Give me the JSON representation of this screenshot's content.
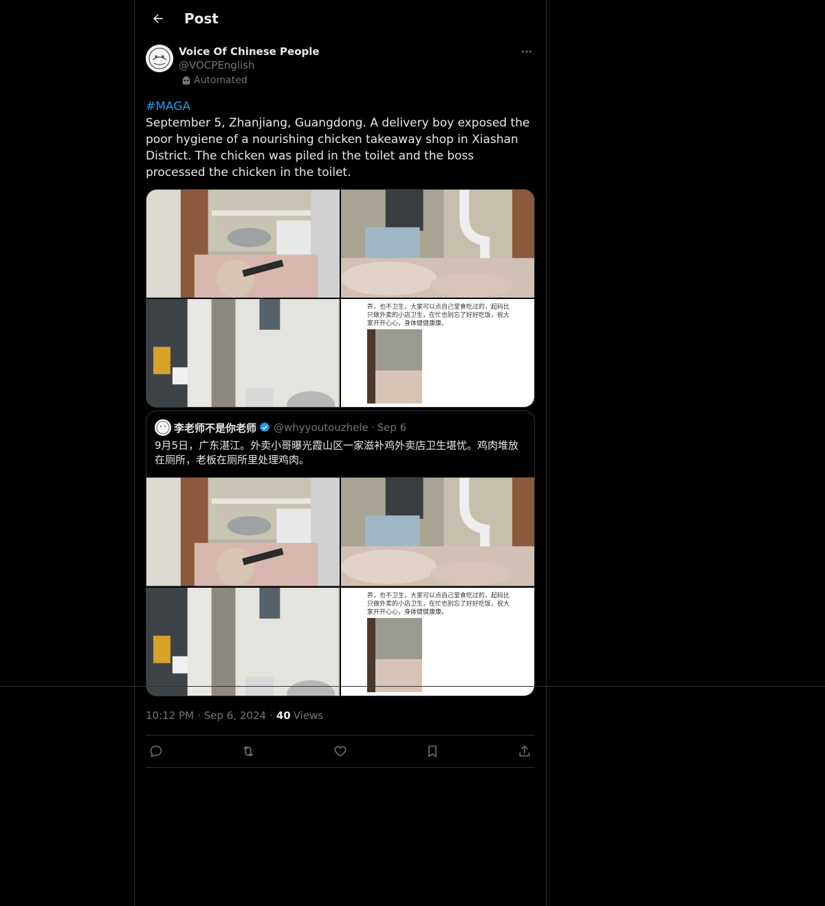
{
  "header": {
    "title": "Post"
  },
  "post": {
    "author_name": "Voice Of Chinese People",
    "author_handle": "@VOCPEnglish",
    "automated_label": "Automated",
    "hashtag": "#MAGA",
    "text": "September 5, Zhanjiang, Guangdong. A delivery boy exposed the poor hygiene of a nourishing chicken takeaway shop in Xiashan District. The chicken was piled in the toilet and the boss processed the chicken in the toilet.",
    "time": "10:12 PM",
    "date": "Sep 6, 2024",
    "views_count": "40",
    "views_label": "Views",
    "separator": "·"
  },
  "quote": {
    "author_name": "李老师不是你老师",
    "author_handle": "@whyyoutouzhele",
    "date": "Sep 6",
    "separator": "·",
    "text": "9月5日，广东湛江。外卖小哥曝光霞山区一家滋补鸡外卖店卫生堪忧。鸡肉堆放在厕所，老板在厕所里处理鸡肉。"
  },
  "screenshot_text": {
    "line1": "养，也不卫生，大家可以点自己堂食吃过的，起码比",
    "line2": "只做外卖的小店卫生，在忙也别忘了好好吃饭，祝大",
    "line3": "家开开心心，身体健健康康。"
  },
  "colors": {
    "background": "#000000",
    "text": "#e7e9ea",
    "muted": "#71767b",
    "accent": "#1d9bf0",
    "border": "#2f3336"
  }
}
